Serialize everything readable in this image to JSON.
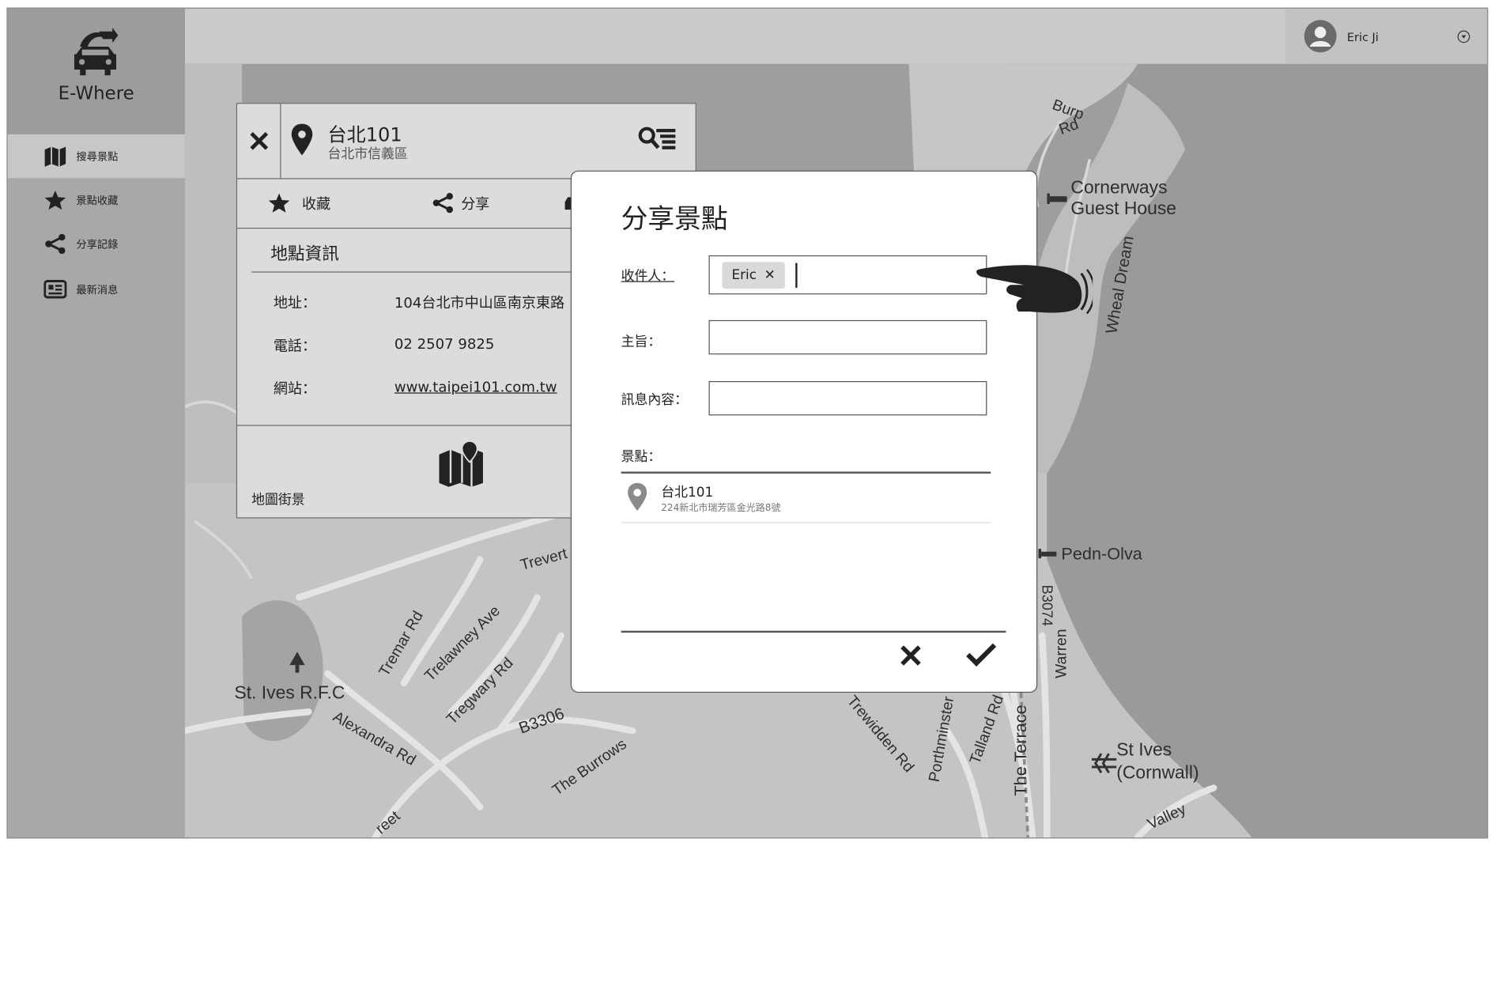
{
  "app": {
    "name": "E-Where"
  },
  "sidebar": {
    "items": [
      {
        "label": "搜尋景點",
        "icon": "map-icon",
        "active": true
      },
      {
        "label": "景點收藏",
        "icon": "star-icon",
        "active": false
      },
      {
        "label": "分享記錄",
        "icon": "share-icon",
        "active": false
      },
      {
        "label": "最新消息",
        "icon": "news-icon",
        "active": false
      }
    ]
  },
  "user": {
    "name": "Eric Ji"
  },
  "map": {
    "labels": [
      "Burp",
      "Rd",
      "Cornerways",
      "Guest House",
      "Wheal Dream",
      "Pedn-Olva",
      "St. Ives R.F.C",
      "Tremar Rd",
      "Trelawney Ave",
      "Tregwary Rd",
      "Alexandra Rd",
      "B3306",
      "The Burrows",
      "Trevert",
      "Trewidden Rd",
      "Porthminster",
      "Talland Rd",
      "The Terrace",
      "B3074",
      "Warren",
      "St Ives",
      "(Cornwall)",
      "Valley",
      "reet"
    ]
  },
  "place": {
    "title": "台北101",
    "subtitle": "台北市信義區",
    "actions": {
      "favorite": "收藏",
      "share": "分享"
    },
    "info_title": "地點資訊",
    "address_label": "地址：",
    "address": "104台北市中山區南京東路",
    "phone_label": "電話：",
    "phone": "02 2507 9825",
    "website_label": "網站：",
    "website": "www.taipei101.com.tw",
    "streetview_label": "地圖街景"
  },
  "share_dialog": {
    "title": "分享景點",
    "recipient_label": "收件人：",
    "recipients": [
      "Eric"
    ],
    "subject_label": "主旨：",
    "subject_value": "",
    "message_label": "訊息內容：",
    "message_value": "",
    "spots_label": "景點：",
    "spot": {
      "name": "台北101",
      "address": "224新北市瑞芳區金光路8號"
    }
  }
}
